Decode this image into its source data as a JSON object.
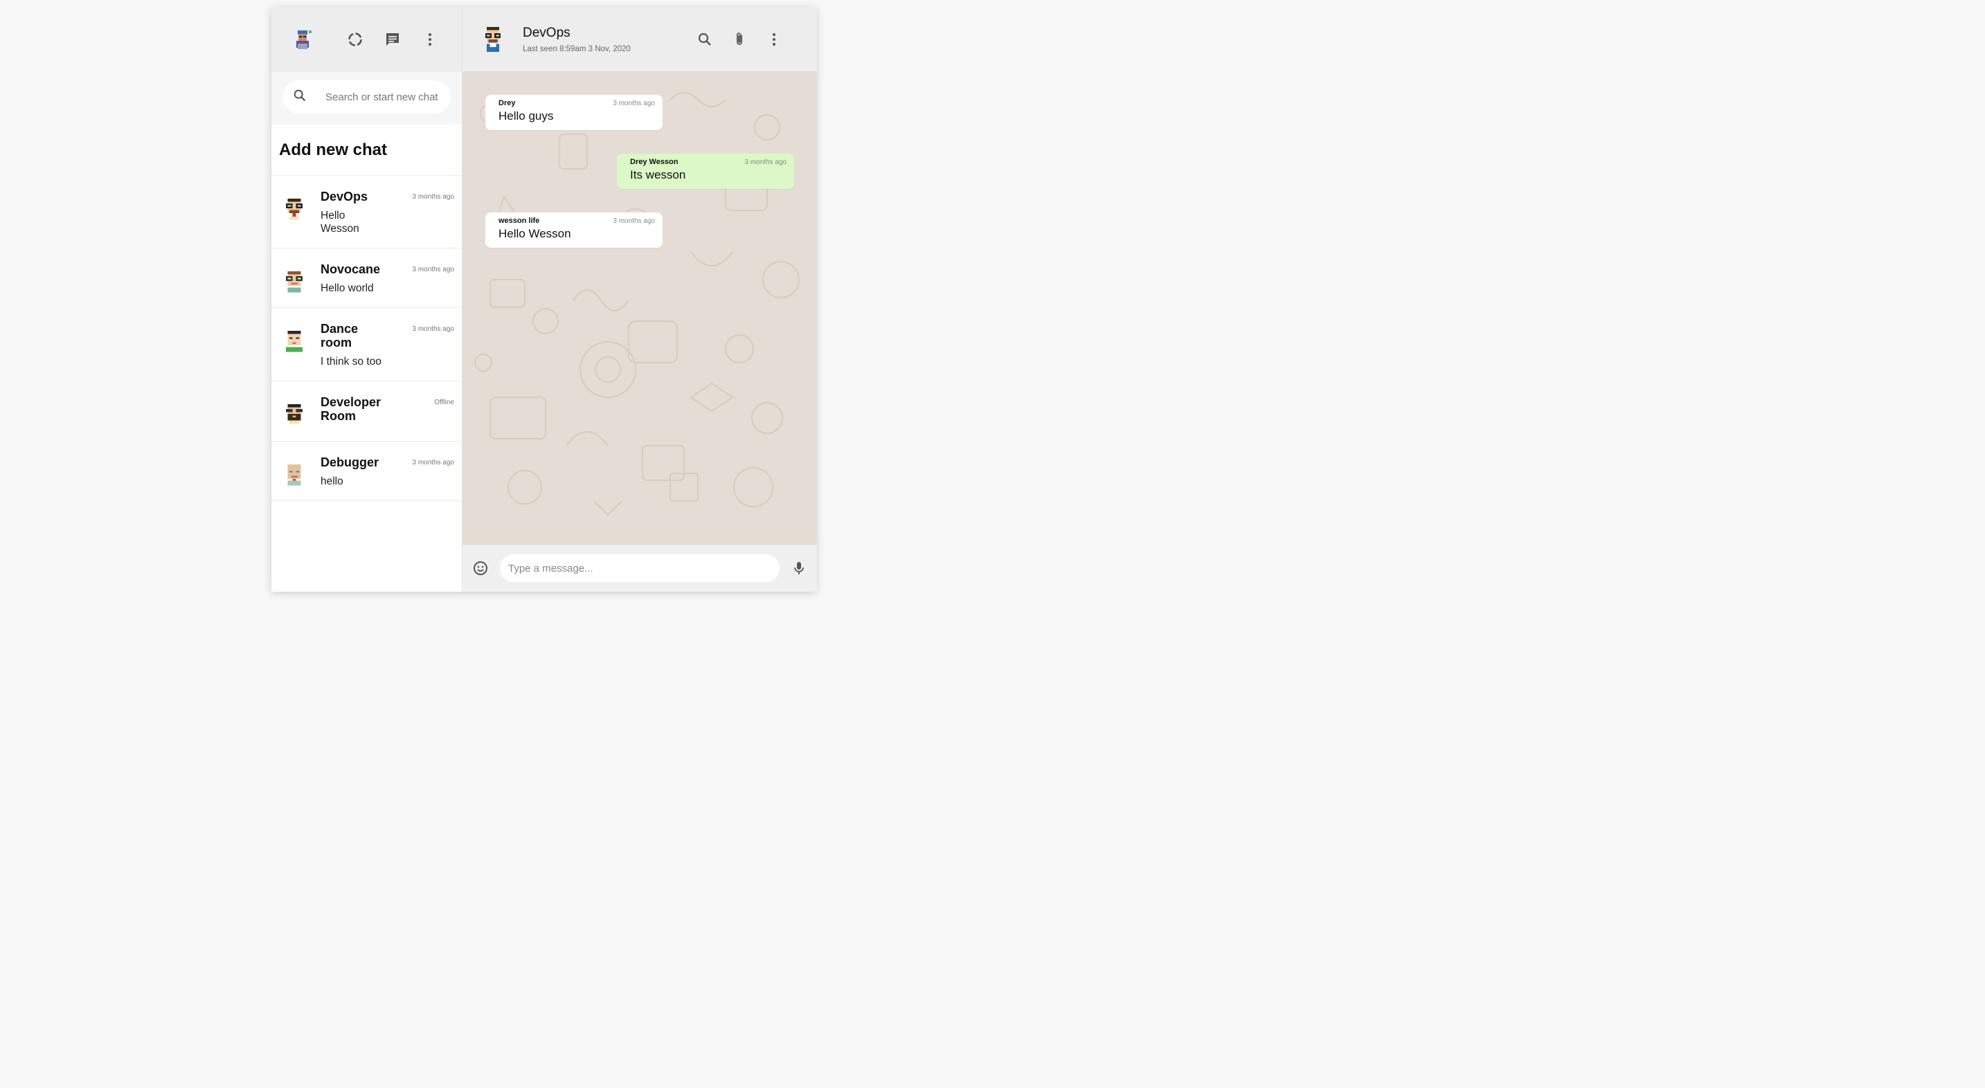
{
  "sidebar": {
    "search_placeholder": "Search or start new chat",
    "add_chat_label": "Add new chat",
    "chats": [
      {
        "name": "DevOps",
        "last": "Hello Wesson",
        "time": "3 months ago",
        "avatar": "nerd-glasses-avatar"
      },
      {
        "name": "Novocane",
        "last": "Hello world",
        "time": "3 months ago",
        "avatar": "brown-hair-glasses-avatar"
      },
      {
        "name": "Dance room",
        "last": "I think so too",
        "time": "3 months ago",
        "avatar": "dark-hair-avatar"
      },
      {
        "name": "Developer Room",
        "last": "",
        "time": "Offline",
        "avatar": "bearded-avatar"
      },
      {
        "name": "Debugger",
        "last": "hello",
        "time": "3 months ago",
        "avatar": "bald-avatar"
      }
    ]
  },
  "chat": {
    "title": "DevOps",
    "subtitle": "Last seen 8:59am 3 Nov, 2020",
    "messages": [
      {
        "name": "Drey",
        "text": "Hello guys",
        "time": "3 months ago",
        "mine": false
      },
      {
        "name": "Drey Wesson",
        "text": "Its wesson",
        "time": "3 months ago",
        "mine": true
      },
      {
        "name": "wesson life",
        "text": "Hello Wesson",
        "time": "3 months ago",
        "mine": false
      }
    ],
    "input_placeholder": "Type a message..."
  },
  "colors": {
    "header_bg": "#ededed",
    "chat_bg": "#e5ddd5",
    "outgoing_bubble": "#dcf8c6",
    "icon_gray": "#555555"
  }
}
